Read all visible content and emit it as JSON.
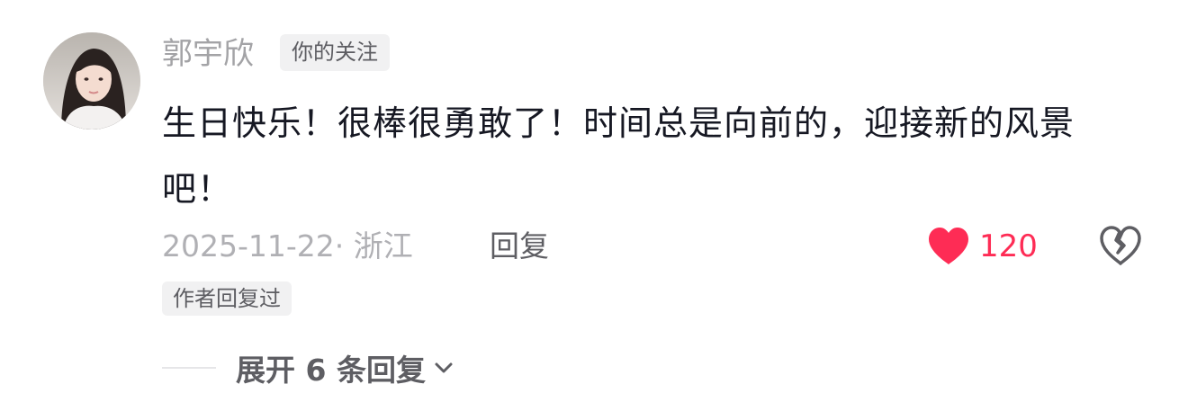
{
  "comment": {
    "username": "郭宇欣",
    "follow_tag": "你的关注",
    "text": "生日快乐！很棒很勇敢了！时间总是向前的，迎接新的风景吧！",
    "date_location": "2025-11-22· 浙江",
    "reply_label": "回复",
    "like_count": "120",
    "liked": true,
    "author_replied_tag": "作者回复过",
    "expand_replies_label": "展开 6 条回复",
    "icons": {
      "like": "heart-filled-icon",
      "dislike": "broken-heart-icon",
      "expand": "chevron-down-icon"
    },
    "colors": {
      "like": "#fe2c55",
      "username": "#a3a3a6",
      "text": "#161823"
    }
  }
}
